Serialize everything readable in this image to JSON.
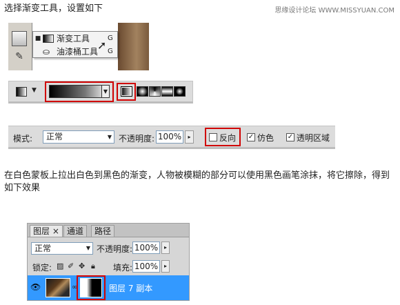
{
  "step1": {
    "text": "选择渐变工具，设置如下"
  },
  "watermark": "思缘设计论坛 WWW.MISSYUAN.COM",
  "tool_menu": {
    "items": [
      {
        "bullet": "■",
        "label": "渐变工具",
        "key": "G"
      },
      {
        "bullet": "",
        "label": "油漆桶工具",
        "key": "G"
      }
    ]
  },
  "options_bar": {
    "gradient_types": [
      "linear",
      "radial",
      "angle",
      "reflected",
      "diamond"
    ],
    "selected_type": "linear"
  },
  "mode_bar": {
    "mode_label": "模式:",
    "mode_value": "正常",
    "opacity_label": "不透明度:",
    "opacity_value": "100%",
    "reverse_label": "反向",
    "reverse_checked": false,
    "dither_label": "仿色",
    "dither_checked": true,
    "transparency_label": "透明区域",
    "transparency_checked": true
  },
  "step2": {
    "text": "在白色蒙板上拉出白色到黑色的渐变，人物被模糊的部分可以使用黑色画笔涂抹，将它擦除，得到如下效果"
  },
  "layers_panel": {
    "tabs": [
      "图层 ×",
      "通道",
      "路径"
    ],
    "active_tab": 0,
    "blend_mode": "正常",
    "opacity_label": "不透明度:",
    "opacity_value": "100%",
    "lock_label": "锁定:",
    "fill_label": "填充:",
    "fill_value": "100%",
    "layer_name": "图层 7 副本"
  },
  "colors": {
    "highlight_box": "#d00000",
    "selected_layer": "#3399ff",
    "panel_bg": "#dcdcdc"
  }
}
